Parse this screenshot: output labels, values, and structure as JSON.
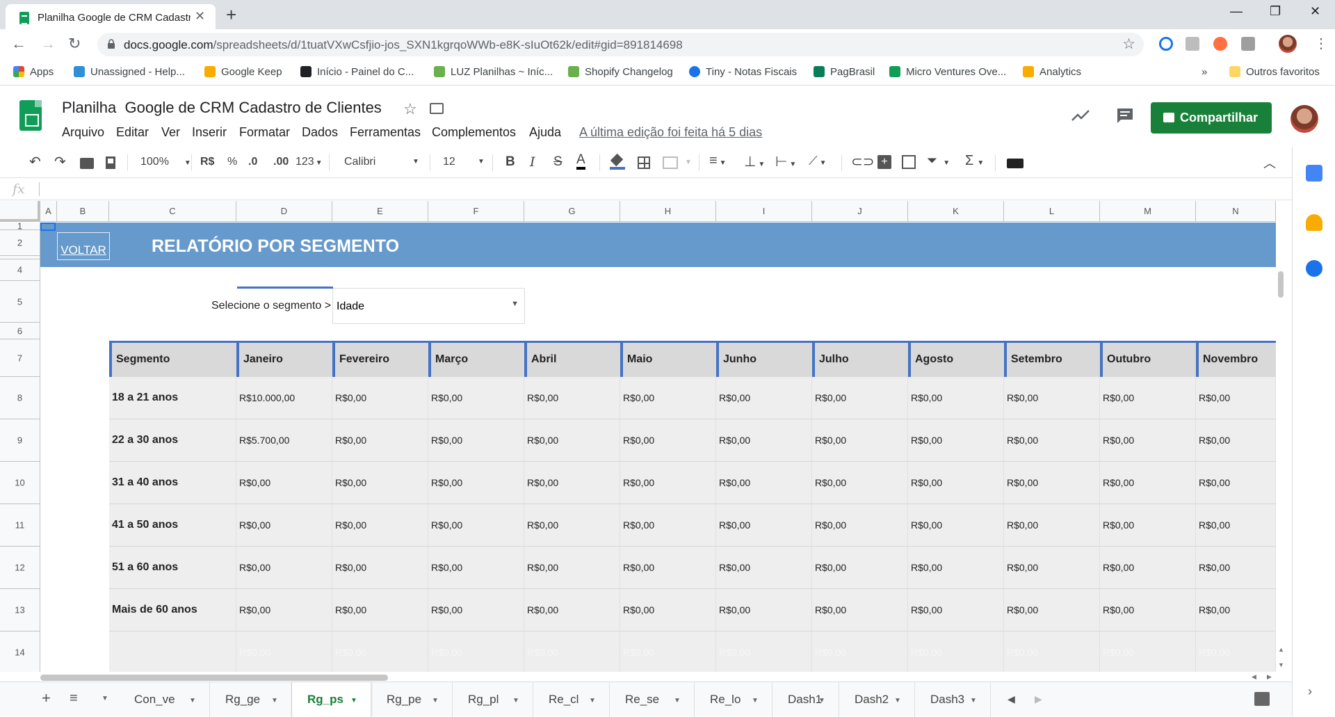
{
  "browser": {
    "tab_title": "Planilha Google de CRM Cadastro de Clientes",
    "url_host": "docs.google.com",
    "url_path": "/spreadsheets/d/1tuatVXwCsfjio-jos_SXN1kgrqoWWb-e8K-sIuOt62k/edit#gid=891814698"
  },
  "bookmarks": [
    {
      "label": "Apps",
      "icon": "apps-grid-icon",
      "color": "#ea4335"
    },
    {
      "label": "Unassigned - Help...",
      "icon": "zendesk-icon",
      "color": "#2f8fd8"
    },
    {
      "label": "Google Keep",
      "icon": "keep-icon",
      "color": "#f9ab00"
    },
    {
      "label": "Início - Painel do C...",
      "icon": "chart-up-icon",
      "color": "#202124"
    },
    {
      "label": "LUZ Planilhas ~ Iníc...",
      "icon": "shopify-bag-icon",
      "color": "#6ab04c"
    },
    {
      "label": "Shopify Changelog",
      "icon": "shopify-bag-icon",
      "color": "#6ab04c"
    },
    {
      "label": "Tiny - Notas Fiscais",
      "icon": "tiny-dots-icon",
      "color": "#1a73e8"
    },
    {
      "label": "PagBrasil",
      "icon": "pb-icon",
      "color": "#0a7d57"
    },
    {
      "label": "Micro Ventures Ove...",
      "icon": "sheets-icon",
      "color": "#0f9d58"
    },
    {
      "label": "Analytics",
      "icon": "analytics-icon",
      "color": "#f9ab00"
    }
  ],
  "other_bookmarks": "Outros favoritos",
  "more_bookmarks": "»",
  "doc": {
    "title": "Planilha  Google de CRM Cadastro de Clientes",
    "menus": [
      "Arquivo",
      "Editar",
      "Ver",
      "Inserir",
      "Formatar",
      "Dados",
      "Ferramentas",
      "Complementos",
      "Ajuda"
    ],
    "last_edit": "A última edição foi feita há 5 dias",
    "share": "Compartilhar"
  },
  "toolbar": {
    "zoom": "100%",
    "currency": "R$",
    "percent": "%",
    "dec_less": ".0",
    "dec_more": ".00",
    "format": "123",
    "font": "Calibri",
    "size": "12",
    "bold": "B",
    "italic": "I",
    "strike": "S",
    "text_color": "A"
  },
  "formula_bar": {
    "fx": "fx",
    "value": ""
  },
  "columns": [
    "A",
    "B",
    "C",
    "D",
    "E",
    "F",
    "G",
    "H",
    "I",
    "J",
    "K",
    "L",
    "M",
    "N"
  ],
  "rows": [
    "1",
    "2",
    "",
    "4",
    "5",
    "6",
    "7",
    "8",
    "9",
    "10",
    "11",
    "12",
    "13",
    "14"
  ],
  "report": {
    "back": "VOLTAR",
    "title": "RELATÓRIO POR SEGMENTO",
    "selector_label": "Selecione o segmento >",
    "selector_value": "Idade"
  },
  "table": {
    "headers": [
      "Segmento",
      "Janeiro",
      "Fevereiro",
      "Março",
      "Abril",
      "Maio",
      "Junho",
      "Julho",
      "Agosto",
      "Setembro",
      "Outubro",
      "Novembro"
    ],
    "rows": [
      {
        "segment": "18 a 21 anos",
        "values": [
          "R$10.000,00",
          "R$0,00",
          "R$0,00",
          "R$0,00",
          "R$0,00",
          "R$0,00",
          "R$0,00",
          "R$0,00",
          "R$0,00",
          "R$0,00",
          "R$0,00"
        ]
      },
      {
        "segment": "22 a 30 anos",
        "values": [
          "R$5.700,00",
          "R$0,00",
          "R$0,00",
          "R$0,00",
          "R$0,00",
          "R$0,00",
          "R$0,00",
          "R$0,00",
          "R$0,00",
          "R$0,00",
          "R$0,00"
        ]
      },
      {
        "segment": "31 a 40 anos",
        "values": [
          "R$0,00",
          "R$0,00",
          "R$0,00",
          "R$0,00",
          "R$0,00",
          "R$0,00",
          "R$0,00",
          "R$0,00",
          "R$0,00",
          "R$0,00",
          "R$0,00"
        ]
      },
      {
        "segment": "41 a 50 anos",
        "values": [
          "R$0,00",
          "R$0,00",
          "R$0,00",
          "R$0,00",
          "R$0,00",
          "R$0,00",
          "R$0,00",
          "R$0,00",
          "R$0,00",
          "R$0,00",
          "R$0,00"
        ]
      },
      {
        "segment": "51 a 60 anos",
        "values": [
          "R$0,00",
          "R$0,00",
          "R$0,00",
          "R$0,00",
          "R$0,00",
          "R$0,00",
          "R$0,00",
          "R$0,00",
          "R$0,00",
          "R$0,00",
          "R$0,00"
        ]
      },
      {
        "segment": "Mais de 60 anos",
        "values": [
          "R$0,00",
          "R$0,00",
          "R$0,00",
          "R$0,00",
          "R$0,00",
          "R$0,00",
          "R$0,00",
          "R$0,00",
          "R$0,00",
          "R$0,00",
          "R$0,00"
        ]
      }
    ],
    "ghost_row": [
      "R$0,00",
      "R$0,00",
      "R$0,00",
      "R$0,00",
      "R$0,00",
      "R$0,00",
      "R$0,00",
      "R$0,00",
      "R$0,00",
      "R$0,00",
      "R$0,00"
    ]
  },
  "sheets": [
    "Con_ve",
    "Rg_ge",
    "Rg_ps",
    "Rg_pe",
    "Rg_pl",
    "Re_cl",
    "Re_se",
    "Re_lo",
    "Dash1",
    "Dash2",
    "Dash3"
  ],
  "active_sheet": "Rg_ps",
  "colors": {
    "accent_green": "#188038",
    "banner_blue": "#6699cc",
    "header_border": "#4472c4",
    "cell_fill": "#eeeeee"
  }
}
